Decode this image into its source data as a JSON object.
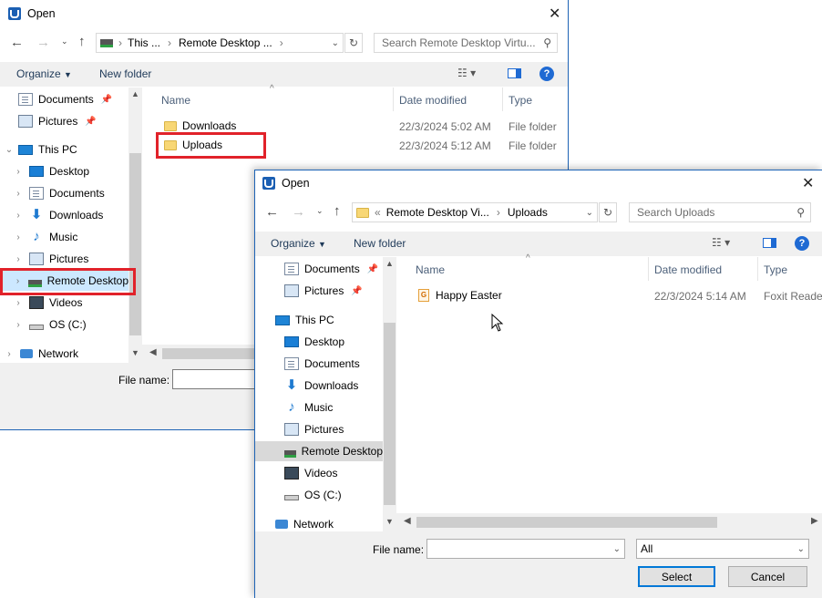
{
  "dialog_back": {
    "title": "Open",
    "address": {
      "segments": [
        "This ...",
        "Remote Desktop ..."
      ]
    },
    "search_placeholder": "Search Remote Desktop Virtu...",
    "toolbar": {
      "organize": "Organize",
      "new_folder": "New folder"
    },
    "nav": {
      "items": [
        {
          "label": "Documents"
        },
        {
          "label": "Pictures"
        },
        {
          "label": "This PC"
        },
        {
          "label": "Desktop"
        },
        {
          "label": "Documents"
        },
        {
          "label": "Downloads"
        },
        {
          "label": "Music"
        },
        {
          "label": "Pictures"
        },
        {
          "label": "Remote Desktop"
        },
        {
          "label": "Videos"
        },
        {
          "label": "OS (C:)"
        },
        {
          "label": "Network"
        }
      ]
    },
    "columns": {
      "name": "Name",
      "date": "Date modified",
      "type": "Type"
    },
    "files": [
      {
        "name": "Downloads",
        "date": "22/3/2024 5:02 AM",
        "type": "File folder"
      },
      {
        "name": "Uploads",
        "date": "22/3/2024 5:12 AM",
        "type": "File folder"
      }
    ],
    "file_name_label": "File name:"
  },
  "dialog_front": {
    "title": "Open",
    "address": {
      "prefix": "«",
      "segments": [
        "Remote Desktop Vi...",
        "Uploads"
      ]
    },
    "search_placeholder": "Search Uploads",
    "toolbar": {
      "organize": "Organize",
      "new_folder": "New folder"
    },
    "nav": {
      "items": [
        {
          "label": "Documents"
        },
        {
          "label": "Pictures"
        },
        {
          "label": "This PC"
        },
        {
          "label": "Desktop"
        },
        {
          "label": "Documents"
        },
        {
          "label": "Downloads"
        },
        {
          "label": "Music"
        },
        {
          "label": "Pictures"
        },
        {
          "label": "Remote Desktop"
        },
        {
          "label": "Videos"
        },
        {
          "label": "OS (C:)"
        },
        {
          "label": "Network"
        }
      ]
    },
    "columns": {
      "name": "Name",
      "date": "Date modified",
      "type": "Type"
    },
    "files": [
      {
        "name": "Happy Easter",
        "date": "22/3/2024 5:14 AM",
        "type": "Foxit Reader"
      }
    ],
    "file_name_label": "File name:",
    "file_name_value": "",
    "filter_value": "All",
    "select_button": "Select",
    "cancel_button": "Cancel"
  },
  "icons": {
    "pdf_badge": "G"
  },
  "colors": {
    "accent": "#1d63b5",
    "highlight": "#e1222a",
    "help": "#1f6ad3"
  }
}
